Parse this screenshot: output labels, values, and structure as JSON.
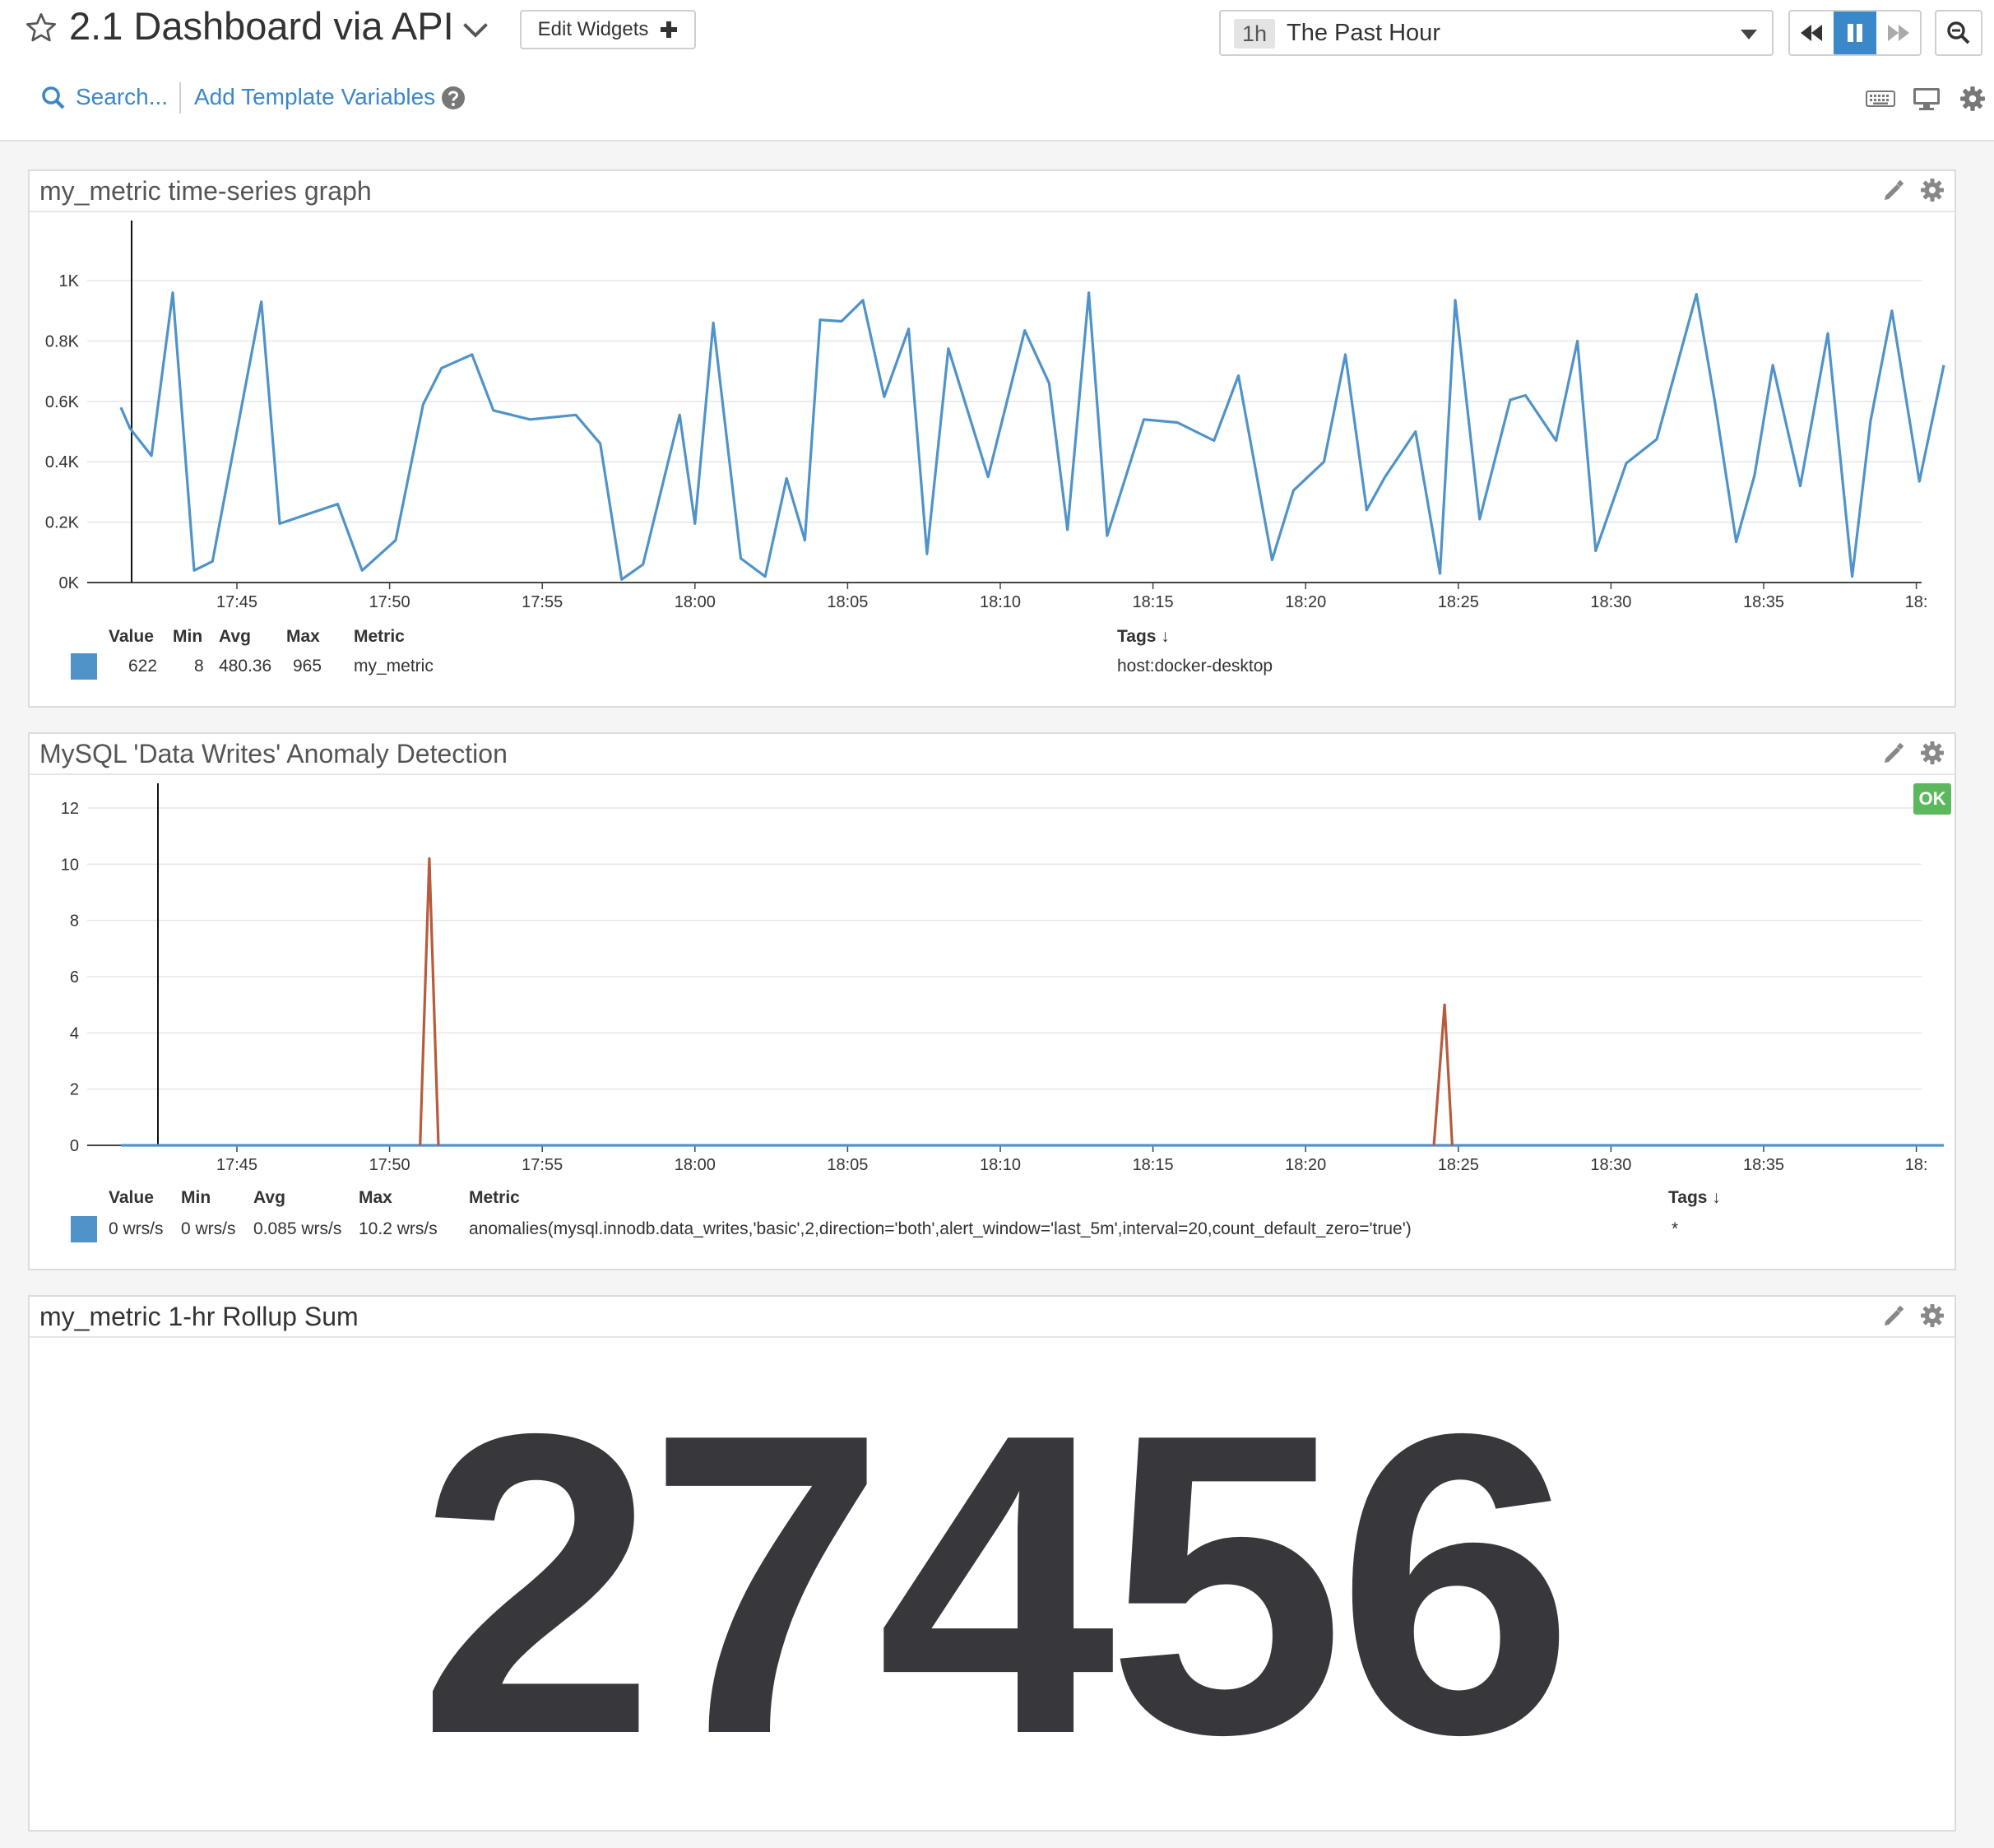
{
  "header": {
    "title": "2.1 Dashboard via API",
    "edit_widgets_label": "Edit Widgets",
    "time_badge": "1h",
    "time_label": "The Past Hour",
    "search_label": "Search...",
    "template_vars_label": "Add Template Variables"
  },
  "colors": {
    "accent": "#3a87c9",
    "series_blue": "#4f93c9",
    "anomaly_red": "#b85a3c",
    "ok_green": "#5cb85c"
  },
  "widgets": {
    "timeseries": {
      "title": "my_metric time-series graph",
      "legend_headers": {
        "value": "Value",
        "min": "Min",
        "avg": "Avg",
        "max": "Max",
        "metric": "Metric",
        "tags": "Tags ↓"
      },
      "legend_row": {
        "value": "622",
        "min": "8",
        "avg": "480.36",
        "max": "965",
        "metric": "my_metric",
        "tags": "host:docker-desktop"
      }
    },
    "anomaly": {
      "title": "MySQL 'Data Writes' Anomaly Detection",
      "status": "OK",
      "legend_headers": {
        "value": "Value",
        "min": "Min",
        "avg": "Avg",
        "max": "Max",
        "metric": "Metric",
        "tags": "Tags ↓"
      },
      "legend_row": {
        "value": "0 wrs/s",
        "min": "0 wrs/s",
        "avg": "0.085 wrs/s",
        "max": "10.2 wrs/s",
        "metric": "anomalies(mysql.innodb.data_writes,'basic',2,direction='both',alert_window='last_5m',interval=20,count_default_zero='true')",
        "tags": "*"
      }
    },
    "rollup": {
      "title": "my_metric 1-hr Rollup Sum",
      "value": "27456"
    }
  },
  "chart_data": [
    {
      "type": "line",
      "x_ticks": [
        "17:45",
        "17:50",
        "17:55",
        "18:00",
        "18:05",
        "18:10",
        "18:15",
        "18:20",
        "18:25",
        "18:30",
        "18:35",
        "18:"
      ],
      "y_ticks": [
        "0K",
        "0.2K",
        "0.4K",
        "0.6K",
        "0.8K",
        "1K"
      ],
      "ylim": [
        0,
        1150
      ],
      "x_start_min": -3.8,
      "x_end_min": 55.9,
      "grid": true,
      "series": [
        {
          "color": "#4f93c9",
          "x_min": [
            -3.8,
            -3.5,
            -2.8,
            -2.1,
            -1.4,
            -0.8,
            0.8,
            1.4,
            3.3,
            4.1,
            5.2,
            6.1,
            6.7,
            7.7,
            8.4,
            9.6,
            11.1,
            11.9,
            12.6,
            13.3,
            14.5,
            15.0,
            15.6,
            16.5,
            17.3,
            18.0,
            18.6,
            19.1,
            19.8,
            20.5,
            21.2,
            22.0,
            22.6,
            23.3,
            24.6,
            25.8,
            26.6,
            27.2,
            27.9,
            28.5,
            29.7,
            30.8,
            32.0,
            32.8,
            33.9,
            34.6,
            35.6,
            36.3,
            37.0,
            37.6,
            38.6,
            39.4,
            39.9,
            40.7,
            41.7,
            42.2,
            43.2,
            43.9,
            44.5,
            45.5,
            46.5,
            47.8,
            48.4,
            49.1,
            49.7,
            50.3,
            51.2,
            52.1,
            52.9,
            53.5,
            54.2,
            55.1,
            55.9
          ],
          "y": [
            580,
            510,
            420,
            960,
            40,
            70,
            930,
            195,
            260,
            40,
            140,
            590,
            710,
            755,
            570,
            540,
            555,
            460,
            10,
            60,
            555,
            195,
            860,
            80,
            20,
            345,
            140,
            870,
            865,
            935,
            615,
            840,
            95,
            775,
            350,
            835,
            660,
            175,
            960,
            155,
            540,
            530,
            470,
            685,
            75,
            305,
            400,
            755,
            240,
            350,
            500,
            30,
            935,
            210,
            605,
            620,
            470,
            800,
            105,
            395,
            475,
            955,
            600,
            135,
            355,
            720,
            320,
            825,
            20,
            535,
            900,
            335,
            720
          ]
        }
      ]
    },
    {
      "type": "line",
      "x_ticks": [
        "17:45",
        "17:50",
        "17:55",
        "18:00",
        "18:05",
        "18:10",
        "18:15",
        "18:20",
        "18:25",
        "18:30",
        "18:35",
        "18:"
      ],
      "y_ticks": [
        "0",
        "2",
        "4",
        "6",
        "8",
        "10",
        "12"
      ],
      "ylim": [
        0,
        13
      ],
      "grid": true,
      "series": [
        {
          "name": "",
          "color": "#4f93c9",
          "x_min": [
            -3.8,
            55.9
          ],
          "y": [
            0,
            0
          ]
        },
        {
          "color": "#b85a3c",
          "x_min": [
            6.0,
            6.3,
            6.6
          ],
          "y": [
            0,
            10.2,
            0
          ]
        },
        {
          "color": "#b85a3c",
          "x_min": [
            39.2,
            39.55,
            39.8
          ],
          "y": [
            0,
            5.0,
            0
          ]
        }
      ]
    }
  ]
}
